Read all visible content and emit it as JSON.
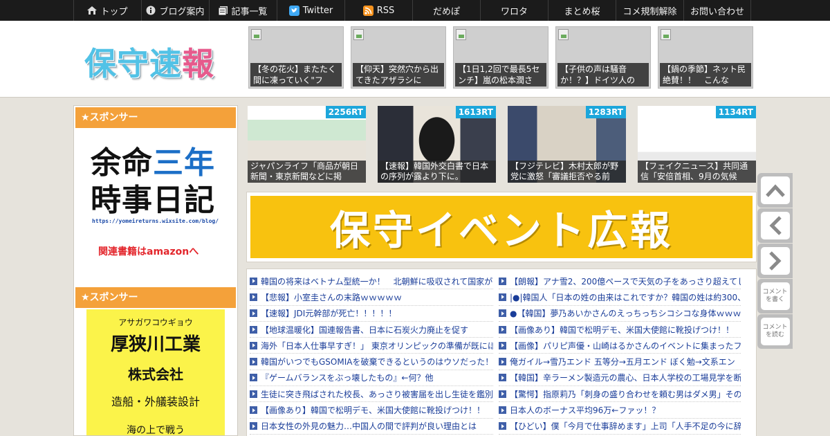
{
  "nav": {
    "items": [
      {
        "label": "トップ",
        "icon": "home-icon"
      },
      {
        "label": "ブログ案内",
        "icon": "info-icon"
      },
      {
        "label": "記事一覧",
        "icon": "list-icon"
      },
      {
        "label": "Twitter",
        "icon": "twitter-icon"
      },
      {
        "label": "RSS",
        "icon": "rss-icon"
      },
      {
        "label": "だめぽ",
        "icon": ""
      },
      {
        "label": "ワロタ",
        "icon": ""
      },
      {
        "label": "まとめ桜",
        "icon": ""
      },
      {
        "label": "コメ規制解除",
        "icon": ""
      },
      {
        "label": "お問い合わせ",
        "icon": ""
      }
    ]
  },
  "header": {
    "logo_part1": "保守速",
    "logo_part2": "報",
    "thumbs": [
      {
        "caption": "【冬の花火】またたく間に凍っていく\"フ"
      },
      {
        "caption": "【仰天】突然穴から出てきたアザラシに"
      },
      {
        "caption": "【1日1,2回で最長5センチ】嵐の松本潤さ"
      },
      {
        "caption": "【子供の声は騒音か！？】ドイツ人の"
      },
      {
        "caption": "【鍋の季節】ネット民絶賛！！　こんな"
      }
    ]
  },
  "sidebar": {
    "sponsor_title_1": "★スポンサー",
    "ad1": {
      "line1a": "余命",
      "line1b": "三年",
      "line2": "時事日記",
      "url": "https://yomeireturns.wixsite.com/blog/",
      "amazon": "関連書籍はamazonへ"
    },
    "sponsor_title_2": "★スポンサー",
    "ad2": {
      "kana": "アサガワコウギョウ",
      "name": "厚狭川工業",
      "company": "株式会社",
      "desc": "造船・外艤装設計",
      "more": "海の上で戦う"
    }
  },
  "rt": [
    {
      "count": "2256RT",
      "caption": "ジャパンライフ「商品が朝日新聞・東京新聞などに掲"
    },
    {
      "count": "1613RT",
      "caption": "【速報】韓国外交白書で日本の序列が露より下に。"
    },
    {
      "count": "1283RT",
      "caption": "【フジテレビ】木村太郎が野党に激怒「審議拒否やる前"
    },
    {
      "count": "1134RT",
      "caption": "【フェイクニュース】共同通信「安倍首相、9月の気候"
    }
  ],
  "banner": {
    "text": "保守イベント広報"
  },
  "news_left": [
    "韓国の将来はベトナム型統一か！　北朝鮮に吸収されて国家が",
    "【悲報】小室圭さんの末路ｗｗｗｗｗ",
    "【速報】JDI元幹部が死亡！！！！！",
    "【地球温暖化】国連報告書、日本に石炭火力廃止を促す",
    "海外「日本人仕事早すぎ！」 東京オリンピックの準備が既にほ",
    "韓国がいつでもGSOMIAを破棄できるというのはウソだった！",
    "『ゲームバランスをぶっ壊したもの』←何？他",
    "生徒に突き飛ばされた校長、あっさり被害届を出し生徒を鑑別",
    "【画像あり】韓国で松明デモ、米国大使館に靴投げつけ！！",
    "日本女性の外見の魅力…中国人の間で評判が良い理由とは"
  ],
  "news_right": [
    "【朗報】アナ雪2、200億ペースで天気の子をあっさり超えてし",
    "|●|韓国人「日本の姓の由来はこれですか？韓国の姓は約300、日",
    "●【韓国】夢乃あいかさんのえっちっちシコシコな身体ｗｗｗｗｗ",
    "【画像あり】韓国で松明デモ、米国大使館に靴投げつけ！！",
    "【画像】パリピ声優・山崎はるかさんのイベントに集まったフ",
    "俺ガイル→雪乃エンド 五等分→五月エンド ぼく勉→文系エン",
    "【韓国】辛ラーメン製造元の農心、日本人学校の工場見学を断",
    "【驚愕】指原莉乃「刺身の盛り合わせを頼む男はダメ男」その",
    "日本人のボーナス平均96万←ファッ！？",
    "【ひどい】僕「今月で仕事辞めます」上司「人手不足の今に辞"
  ],
  "sidebtns": {
    "comment_write": "コメントを書く",
    "comment_read": "コメントを読む"
  }
}
